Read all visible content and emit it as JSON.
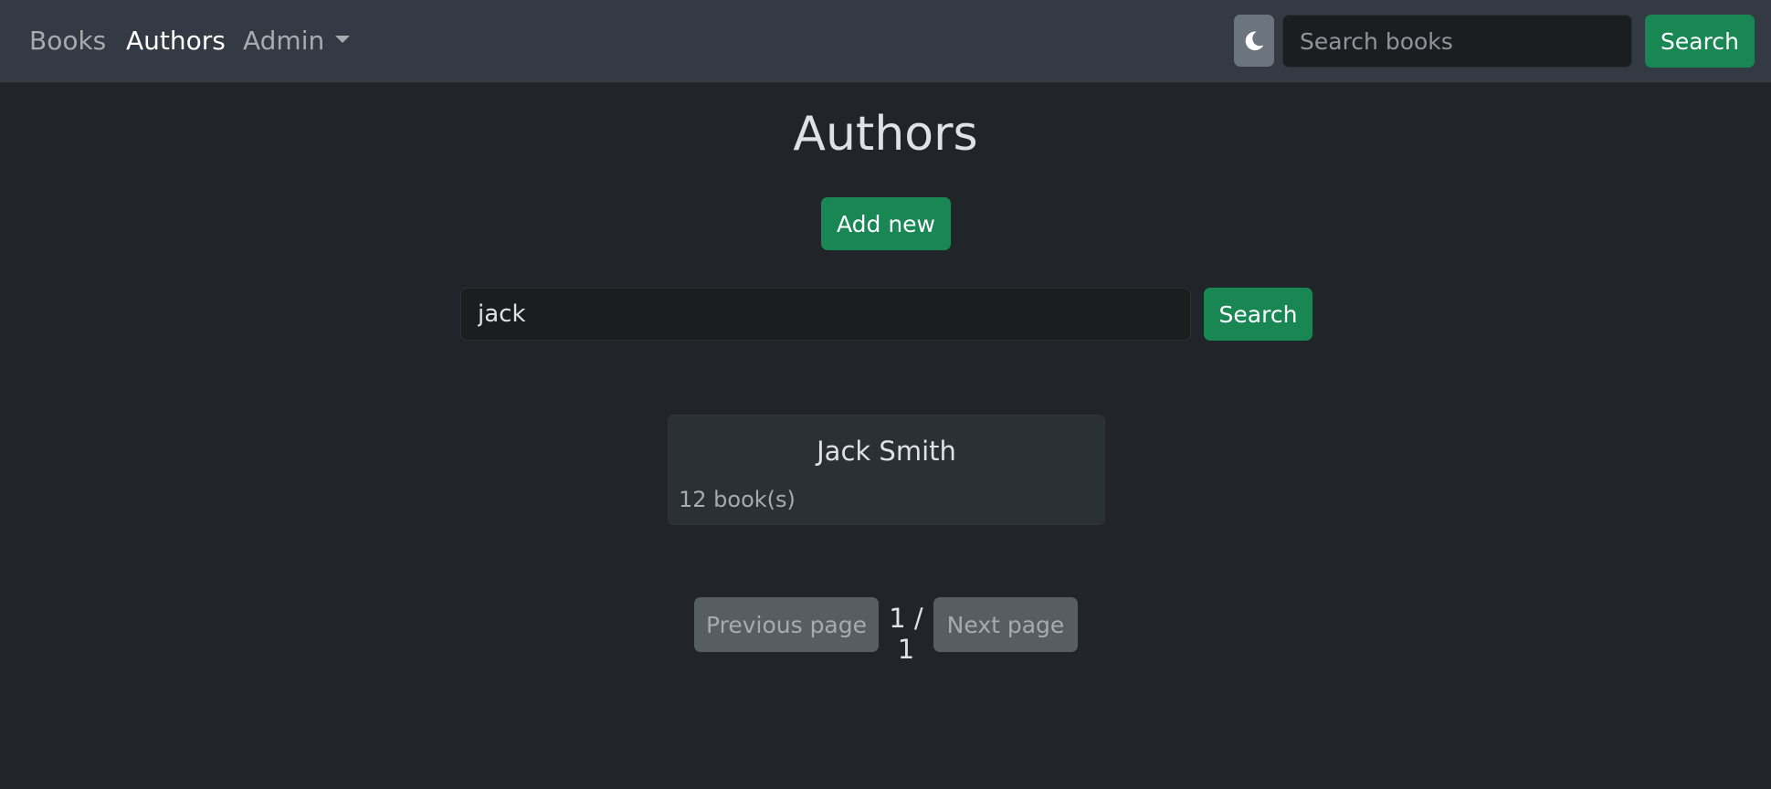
{
  "navbar": {
    "links": {
      "books": "Books",
      "authors": "Authors",
      "admin": "Admin"
    },
    "active_link": "Authors",
    "theme_toggle_icon": "moon-icon",
    "search": {
      "placeholder": "Search books",
      "value": "",
      "button_label": "Search"
    }
  },
  "main": {
    "title": "Authors",
    "add_button_label": "Add new",
    "search": {
      "value": "jack",
      "button_label": "Search"
    },
    "authors": [
      {
        "name": "Jack Smith",
        "book_count": "12 book(s)"
      }
    ],
    "pagination": {
      "previous_label": "Previous page",
      "indicator": "1 / 1",
      "next_label": "Next page"
    }
  },
  "colors": {
    "background": "#212529",
    "navbar": "#343a43",
    "accent_green": "#198754",
    "secondary_button": "#565e64",
    "card": "#2b3035"
  }
}
